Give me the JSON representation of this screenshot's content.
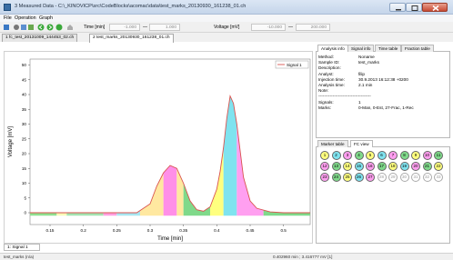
{
  "window": {
    "title": "3 Measured Data - C:\\_KINOVICP\\src\\CodeBlocks\\acomac\\data\\test_marks_20130930_161238_01.ch"
  },
  "menu": [
    "File",
    "Operation",
    "Graph"
  ],
  "toolbar": {
    "time_label": "Time [min]",
    "time_from": "-1.000",
    "time_to": "1.000",
    "voltage_label": "Voltage [mV]",
    "voltage_from": "-10.000",
    "voltage_to": "200.000",
    "icons": [
      "open-icon",
      "tools-icon",
      "list-icon",
      "import-icon",
      "back-icon",
      "forward-icon",
      "play-icon",
      "home-icon"
    ]
  },
  "file_tabs": [
    {
      "label": "1 fc_test_20131009_144453_02.ch",
      "active": false
    },
    {
      "label": "2 test_marks_20130930_161238_01.ch",
      "active": true
    }
  ],
  "chart_data": {
    "type": "line",
    "xlabel": "Time [min]",
    "ylabel": "Voltage [mV]",
    "xlim": [
      0.12,
      0.54
    ],
    "ylim": [
      -4,
      52
    ],
    "x_ticks": [
      "0.15",
      "0.2",
      "0.25",
      "0.3",
      "0.35",
      "0.4",
      "0.45",
      "0.5"
    ],
    "y_ticks": [
      "0",
      "5",
      "10",
      "15",
      "20",
      "25",
      "30",
      "35",
      "40",
      "45",
      "50"
    ],
    "legend": "Signal 1",
    "series": [
      {
        "name": "Signal 1",
        "color": "#d9534f",
        "x": [
          0.12,
          0.24,
          0.28,
          0.3,
          0.31,
          0.32,
          0.33,
          0.34,
          0.35,
          0.36,
          0.37,
          0.38,
          0.39,
          0.4,
          0.405,
          0.41,
          0.415,
          0.42,
          0.425,
          0.43,
          0.44,
          0.45,
          0.46,
          0.48,
          0.5,
          0.54
        ],
        "y": [
          0,
          0,
          0,
          3,
          9,
          13.5,
          16,
          15,
          10,
          4,
          1,
          0.5,
          2,
          8,
          14,
          22,
          32,
          39.5,
          37,
          30,
          12,
          4,
          1.5,
          0.3,
          0,
          0
        ]
      }
    ],
    "fractions": [
      {
        "from": 0.12,
        "to": 0.16,
        "color": "#8fe08f"
      },
      {
        "from": 0.16,
        "to": 0.175,
        "color": "#f8fab8"
      },
      {
        "from": 0.175,
        "to": 0.23,
        "color": "#a3e3b0"
      },
      {
        "from": 0.23,
        "to": 0.25,
        "color": "#ff9fe0"
      },
      {
        "from": 0.25,
        "to": 0.285,
        "color": "#a8e6f0"
      },
      {
        "from": 0.285,
        "to": 0.32,
        "color": "#ffe8a0"
      },
      {
        "from": 0.32,
        "to": 0.34,
        "color": "#ff8fe8"
      },
      {
        "from": 0.34,
        "to": 0.35,
        "color": "#ffe8a0"
      },
      {
        "from": 0.35,
        "to": 0.39,
        "color": "#7fd98a"
      },
      {
        "from": 0.39,
        "to": 0.41,
        "color": "#ffff7f"
      },
      {
        "from": 0.41,
        "to": 0.43,
        "color": "#7fe3ef"
      },
      {
        "from": 0.43,
        "to": 0.47,
        "color": "#ff9ff0"
      },
      {
        "from": 0.47,
        "to": 0.54,
        "color": "#7fd98a"
      }
    ]
  },
  "series_tab": "1: Signal 1",
  "status": {
    "left": "test_marks (n/a)",
    "coords": "0.402960 min ; 3.416777 mV  [1]"
  },
  "right_top_tabs": [
    {
      "label": "Analysis info",
      "active": true
    },
    {
      "label": "Signal info",
      "active": false
    },
    {
      "label": "Time table",
      "active": false
    },
    {
      "label": "Fraction table",
      "active": false
    }
  ],
  "analysis_info": [
    {
      "label": "Method:",
      "value": "Noname"
    },
    {
      "label": "Sample ID:",
      "value": "test_marks"
    },
    {
      "label": "Description:",
      "value": ""
    },
    {
      "label": "Analyst:",
      "value": "filip"
    },
    {
      "label": "Injection time:",
      "value": "30.9.2013 16:12:38 +0200"
    },
    {
      "label": "Analysis time:",
      "value": "2.1 min"
    },
    {
      "label": "Note:",
      "value": ""
    },
    {
      "label": "-------------------------------------",
      "value": ""
    },
    {
      "label": "Signals:",
      "value": "1"
    },
    {
      "label": "Marks:",
      "value": "0-Man, 0-Est, 27-Frac, 1-Rec"
    }
  ],
  "right_bottom_tabs": [
    {
      "label": "Marker table",
      "active": false
    },
    {
      "label": "FC view",
      "active": true
    }
  ],
  "fc_wells": [
    {
      "n": "1",
      "color": "#ffff7f"
    },
    {
      "n": "2",
      "color": "#7fe3ef"
    },
    {
      "n": "3",
      "color": "#ff9ff0"
    },
    {
      "n": "4",
      "color": "#7fd98a"
    },
    {
      "n": "5",
      "color": "#ffff7f"
    },
    {
      "n": "6",
      "color": "#7fe3ef"
    },
    {
      "n": "7",
      "color": "#ff9ff0"
    },
    {
      "n": "8",
      "color": "#7fd98a"
    },
    {
      "n": "9",
      "color": "#ffff7f"
    },
    {
      "n": "10",
      "color": "#ff9ff0"
    },
    {
      "n": "11",
      "color": "#7fd98a"
    },
    {
      "n": "12",
      "color": "#ff9ff0"
    },
    {
      "n": "13",
      "color": "#7fd98a"
    },
    {
      "n": "14",
      "color": "#ffff7f"
    },
    {
      "n": "15",
      "color": "#7fe3ef"
    },
    {
      "n": "16",
      "color": "#ff9ff0"
    },
    {
      "n": "17",
      "color": "#7fd98a"
    },
    {
      "n": "18",
      "color": "#ffff7f"
    },
    {
      "n": "19",
      "color": "#7fe3ef"
    },
    {
      "n": "20",
      "color": "#ff9ff0"
    },
    {
      "n": "21",
      "color": "#7fd98a"
    },
    {
      "n": "22",
      "color": "#ffff7f"
    },
    {
      "n": "23",
      "color": "#ff9ff0"
    },
    {
      "n": "24",
      "color": "#7fd98a"
    },
    {
      "n": "25",
      "color": "#ffff7f"
    },
    {
      "n": "26",
      "color": "#7fe3ef"
    },
    {
      "n": "27",
      "color": "#ff9ff0"
    },
    {
      "n": "28",
      "color": "#ffffff"
    },
    {
      "n": "29",
      "color": "#ffffff"
    },
    {
      "n": "30",
      "color": "#ffffff"
    },
    {
      "n": "31",
      "color": "#ffffff"
    },
    {
      "n": "32",
      "color": "#ffffff"
    },
    {
      "n": "33",
      "color": "#ffffff"
    }
  ]
}
